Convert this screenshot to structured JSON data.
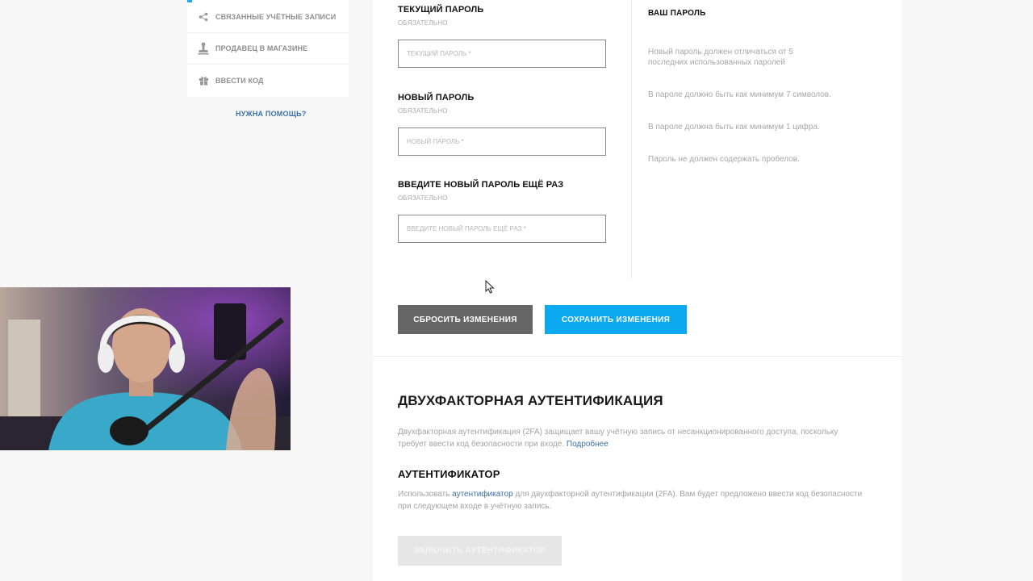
{
  "sidebar": {
    "items": [
      {
        "label": "СВЯЗАННЫЕ УЧЁТНЫЕ ЗАПИСИ",
        "icon": "share-icon"
      },
      {
        "label": "ПРОДАВЕЦ В МАГАЗИНЕ",
        "icon": "stamp-icon"
      },
      {
        "label": "ВВЕСТИ КОД",
        "icon": "gift-icon"
      }
    ],
    "help_link": "НУЖНА ПОМОЩЬ?",
    "accent_color": "#1ba9f5"
  },
  "password_form": {
    "current": {
      "title": "ТЕКУЩИЙ ПАРОЛЬ",
      "required": "ОБЯЗАТЕЛЬНО",
      "placeholder": "ТЕКУЩИЙ ПАРОЛЬ *",
      "value": ""
    },
    "new": {
      "title": "НОВЫЙ ПАРОЛЬ",
      "required": "ОБЯЗАТЕЛЬНО",
      "placeholder": "НОВЫЙ ПАРОЛЬ *",
      "value": ""
    },
    "confirm": {
      "title": "ВВЕДИТЕ НОВЫЙ ПАРОЛЬ ЕЩЁ РАЗ",
      "required": "ОБЯЗАТЕЛЬНО",
      "placeholder": "ВВЕДИТЕ НОВЫЙ ПАРОЛЬ ЕЩЁ РАЗ *",
      "value": ""
    }
  },
  "password_tips": {
    "title": "ВАШ ПАРОЛЬ",
    "items": [
      "Новый пароль должен отличаться от 5 последних использованных паролей",
      "В пароле должно быть как минимум 7 символов.",
      "В пароле должна быть как минимум 1 цифра.",
      "Пароль не должен содержать пробелов."
    ]
  },
  "actions": {
    "reset_label": "СБРОСИТЬ ИЗМЕНЕНИЯ",
    "save_label": "СОХРАНИТЬ ИЗМЕНЕНИЯ",
    "reset_color": "#666666",
    "save_color": "#0aa9f0"
  },
  "two_factor": {
    "title": "ДВУХФАКТОРНАЯ АУТЕНТИФИКАЦИЯ",
    "description": "Двухфакторная аутентификация (2FA) защищает вашу учётную запись от несанкционированного доступа, поскольку требует ввести код безопасности при входе.",
    "more_link": "Подробнее",
    "authenticator": {
      "title": "АУТЕНТИФИКАТОР",
      "desc_prefix": "Использовать",
      "desc_link": "аутентификатор",
      "desc_suffix": "для двухфакторной аутентификации (2FA). Вам будет предложено ввести код безопасности при следующем входе в учётную запись.",
      "enable_label": "ВКЛЮЧИТЬ АУТЕНТИФИКАТОР"
    }
  }
}
